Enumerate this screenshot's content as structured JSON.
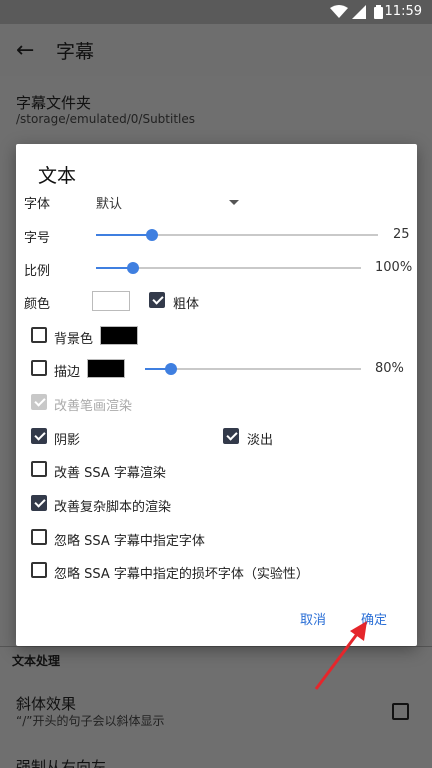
{
  "status": {
    "time": "11:59",
    "icons": [
      "wifi-icon",
      "signal-icon",
      "battery-icon"
    ]
  },
  "appbar": {
    "title": "字幕"
  },
  "background": {
    "folder_title": "字幕文件夹",
    "folder_path": "/storage/emulated/0/Subtitles",
    "section_text_processing": "文本处理",
    "italic_title": "斜体效果",
    "italic_sub": "“/”开头的句子会以斜体显示",
    "force_rtl": "强制从右向左"
  },
  "dialog": {
    "title": "文本",
    "font_label": "字体",
    "font_value": "默认",
    "size_label": "字号",
    "size_value": "25",
    "size_fraction": 0.2,
    "scale_label": "比例",
    "scale_value": "100%",
    "scale_fraction": 0.14,
    "color_label": "颜色",
    "text_color": "#ffffff",
    "bold_label": "粗体",
    "bold_checked": true,
    "bg_color_label": "背景色",
    "bg_color": "#000000",
    "bg_checked": false,
    "border_label": "描边",
    "border_color": "#000000",
    "border_checked": false,
    "border_value": "80%",
    "border_fraction": 0.12,
    "improve_stroke_label": "改善笔画渲染",
    "shadow_label": "阴影",
    "shadow_checked": true,
    "fadeout_label": "淡出",
    "fadeout_checked": true,
    "improve_ssa_label": "改善 SSA 字幕渲染",
    "improve_complex_label": "改善复杂脚本的渲染",
    "ignore_font_label": "忽略 SSA 字幕中指定字体",
    "ignore_broken_font_label": "忽略 SSA 字幕中指定的损坏字体（实验性）",
    "cancel_label": "取消",
    "ok_label": "确定",
    "accent_color": "#3f7fe0"
  }
}
